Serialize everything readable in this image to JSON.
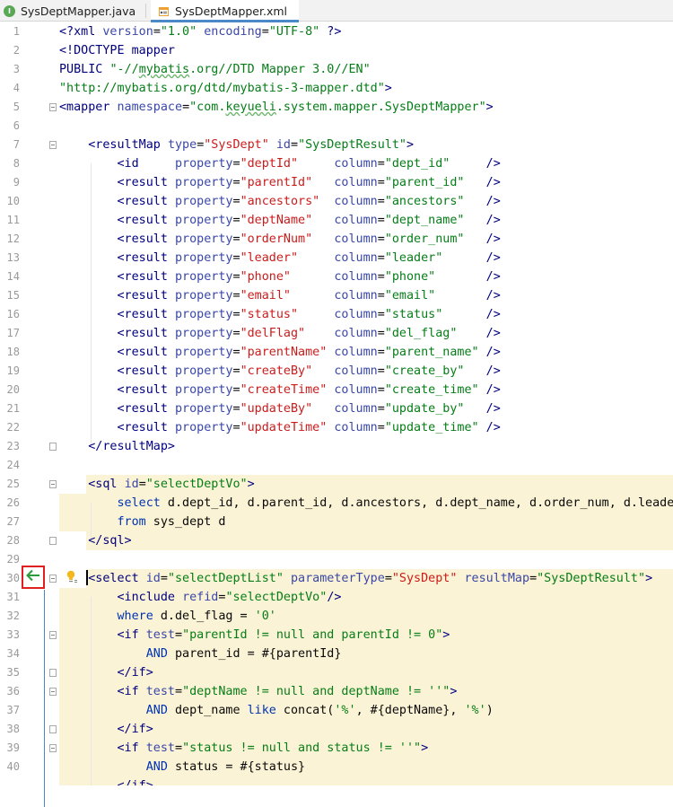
{
  "tabs": [
    {
      "label": "SysDeptMapper.java",
      "icon": "java-interface-icon",
      "active": false
    },
    {
      "label": "SysDeptMapper.xml",
      "icon": "xml-file-icon",
      "active": true
    }
  ],
  "colors": {
    "tag": "#000080",
    "attr": "#3a47a8",
    "value": "#067d17",
    "red_value": "#cc1b1b",
    "keyword": "#0033b3",
    "highlight": "#fbf3d5",
    "accent": "#4a88c7"
  },
  "editor": {
    "line_numbers": [
      "1",
      "2",
      "3",
      "4",
      "5",
      "6",
      "7",
      "8",
      "9",
      "10",
      "11",
      "12",
      "13",
      "14",
      "15",
      "16",
      "17",
      "18",
      "19",
      "20",
      "21",
      "22",
      "23",
      "24",
      "25",
      "26",
      "27",
      "28",
      "29",
      "30",
      "31",
      "32",
      "33",
      "34",
      "35",
      "36",
      "37",
      "38",
      "39",
      "40"
    ],
    "lines": [
      [
        {
          "t": "<?",
          "c": "c-pi"
        },
        {
          "t": "xml ",
          "c": "c-pi"
        },
        {
          "t": "version",
          "c": "c-attr"
        },
        {
          "t": "=",
          "c": "c-txt"
        },
        {
          "t": "\"1.0\"",
          "c": "c-val"
        },
        {
          "t": " ",
          "c": "c-txt"
        },
        {
          "t": "encoding",
          "c": "c-attr"
        },
        {
          "t": "=",
          "c": "c-txt"
        },
        {
          "t": "\"UTF-8\"",
          "c": "c-val"
        },
        {
          "t": " ?>",
          "c": "c-pi"
        }
      ],
      [
        {
          "t": "<!DOCTYPE ",
          "c": "c-tag"
        },
        {
          "t": "mapper",
          "c": "c-tag"
        }
      ],
      [
        {
          "t": "PUBLIC ",
          "c": "c-tag"
        },
        {
          "t": "\"-//",
          "c": "c-val"
        },
        {
          "t": "mybatis",
          "c": "c-val squig"
        },
        {
          "t": ".org//DTD Mapper 3.0//EN\"",
          "c": "c-val"
        }
      ],
      [
        {
          "t": "\"http://mybatis.org/dtd/mybatis-3-mapper.dtd\"",
          "c": "c-val"
        },
        {
          "t": ">",
          "c": "c-tag"
        }
      ],
      [
        {
          "t": "<mapper ",
          "c": "c-tag"
        },
        {
          "t": "namespace",
          "c": "c-attr"
        },
        {
          "t": "=",
          "c": "c-txt"
        },
        {
          "t": "\"com.",
          "c": "c-val"
        },
        {
          "t": "keyueli",
          "c": "c-val squig"
        },
        {
          "t": ".system.mapper.SysDeptMapper\"",
          "c": "c-val"
        },
        {
          "t": ">",
          "c": "c-tag"
        }
      ],
      [],
      [
        {
          "t": "    <resultMap ",
          "c": "c-tag"
        },
        {
          "t": "type",
          "c": "c-attr"
        },
        {
          "t": "=",
          "c": "c-txt"
        },
        {
          "t": "\"SysDept\"",
          "c": "c-red"
        },
        {
          "t": " ",
          "c": "c-txt"
        },
        {
          "t": "id",
          "c": "c-attr"
        },
        {
          "t": "=",
          "c": "c-txt"
        },
        {
          "t": "\"SysDeptResult\"",
          "c": "c-val"
        },
        {
          "t": ">",
          "c": "c-tag"
        }
      ],
      [
        {
          "t": "        <id     ",
          "c": "c-tag"
        },
        {
          "t": "property",
          "c": "c-attr"
        },
        {
          "t": "=",
          "c": "c-txt"
        },
        {
          "t": "\"deptId\"",
          "c": "c-red"
        },
        {
          "t": "     ",
          "c": "c-txt"
        },
        {
          "t": "column",
          "c": "c-attr"
        },
        {
          "t": "=",
          "c": "c-txt"
        },
        {
          "t": "\"dept_id\"",
          "c": "c-val"
        },
        {
          "t": "     />",
          "c": "c-tag"
        }
      ],
      [
        {
          "t": "        <result ",
          "c": "c-tag"
        },
        {
          "t": "property",
          "c": "c-attr"
        },
        {
          "t": "=",
          "c": "c-txt"
        },
        {
          "t": "\"parentId\"",
          "c": "c-red"
        },
        {
          "t": "   ",
          "c": "c-txt"
        },
        {
          "t": "column",
          "c": "c-attr"
        },
        {
          "t": "=",
          "c": "c-txt"
        },
        {
          "t": "\"parent_id\"",
          "c": "c-val"
        },
        {
          "t": "   />",
          "c": "c-tag"
        }
      ],
      [
        {
          "t": "        <result ",
          "c": "c-tag"
        },
        {
          "t": "property",
          "c": "c-attr"
        },
        {
          "t": "=",
          "c": "c-txt"
        },
        {
          "t": "\"ancestors\"",
          "c": "c-red"
        },
        {
          "t": "  ",
          "c": "c-txt"
        },
        {
          "t": "column",
          "c": "c-attr"
        },
        {
          "t": "=",
          "c": "c-txt"
        },
        {
          "t": "\"ancestors\"",
          "c": "c-val"
        },
        {
          "t": "   />",
          "c": "c-tag"
        }
      ],
      [
        {
          "t": "        <result ",
          "c": "c-tag"
        },
        {
          "t": "property",
          "c": "c-attr"
        },
        {
          "t": "=",
          "c": "c-txt"
        },
        {
          "t": "\"deptName\"",
          "c": "c-red"
        },
        {
          "t": "   ",
          "c": "c-txt"
        },
        {
          "t": "column",
          "c": "c-attr"
        },
        {
          "t": "=",
          "c": "c-txt"
        },
        {
          "t": "\"dept_name\"",
          "c": "c-val"
        },
        {
          "t": "   />",
          "c": "c-tag"
        }
      ],
      [
        {
          "t": "        <result ",
          "c": "c-tag"
        },
        {
          "t": "property",
          "c": "c-attr"
        },
        {
          "t": "=",
          "c": "c-txt"
        },
        {
          "t": "\"orderNum\"",
          "c": "c-red"
        },
        {
          "t": "   ",
          "c": "c-txt"
        },
        {
          "t": "column",
          "c": "c-attr"
        },
        {
          "t": "=",
          "c": "c-txt"
        },
        {
          "t": "\"order_num\"",
          "c": "c-val"
        },
        {
          "t": "   />",
          "c": "c-tag"
        }
      ],
      [
        {
          "t": "        <result ",
          "c": "c-tag"
        },
        {
          "t": "property",
          "c": "c-attr"
        },
        {
          "t": "=",
          "c": "c-txt"
        },
        {
          "t": "\"leader\"",
          "c": "c-red"
        },
        {
          "t": "     ",
          "c": "c-txt"
        },
        {
          "t": "column",
          "c": "c-attr"
        },
        {
          "t": "=",
          "c": "c-txt"
        },
        {
          "t": "\"leader\"",
          "c": "c-val"
        },
        {
          "t": "      />",
          "c": "c-tag"
        }
      ],
      [
        {
          "t": "        <result ",
          "c": "c-tag"
        },
        {
          "t": "property",
          "c": "c-attr"
        },
        {
          "t": "=",
          "c": "c-txt"
        },
        {
          "t": "\"phone\"",
          "c": "c-red"
        },
        {
          "t": "      ",
          "c": "c-txt"
        },
        {
          "t": "column",
          "c": "c-attr"
        },
        {
          "t": "=",
          "c": "c-txt"
        },
        {
          "t": "\"phone\"",
          "c": "c-val"
        },
        {
          "t": "       />",
          "c": "c-tag"
        }
      ],
      [
        {
          "t": "        <result ",
          "c": "c-tag"
        },
        {
          "t": "property",
          "c": "c-attr"
        },
        {
          "t": "=",
          "c": "c-txt"
        },
        {
          "t": "\"email\"",
          "c": "c-red"
        },
        {
          "t": "      ",
          "c": "c-txt"
        },
        {
          "t": "column",
          "c": "c-attr"
        },
        {
          "t": "=",
          "c": "c-txt"
        },
        {
          "t": "\"email\"",
          "c": "c-val"
        },
        {
          "t": "       />",
          "c": "c-tag"
        }
      ],
      [
        {
          "t": "        <result ",
          "c": "c-tag"
        },
        {
          "t": "property",
          "c": "c-attr"
        },
        {
          "t": "=",
          "c": "c-txt"
        },
        {
          "t": "\"status\"",
          "c": "c-red"
        },
        {
          "t": "     ",
          "c": "c-txt"
        },
        {
          "t": "column",
          "c": "c-attr"
        },
        {
          "t": "=",
          "c": "c-txt"
        },
        {
          "t": "\"status\"",
          "c": "c-val"
        },
        {
          "t": "      />",
          "c": "c-tag"
        }
      ],
      [
        {
          "t": "        <result ",
          "c": "c-tag"
        },
        {
          "t": "property",
          "c": "c-attr"
        },
        {
          "t": "=",
          "c": "c-txt"
        },
        {
          "t": "\"delFlag\"",
          "c": "c-red"
        },
        {
          "t": "    ",
          "c": "c-txt"
        },
        {
          "t": "column",
          "c": "c-attr"
        },
        {
          "t": "=",
          "c": "c-txt"
        },
        {
          "t": "\"del_flag\"",
          "c": "c-val"
        },
        {
          "t": "    />",
          "c": "c-tag"
        }
      ],
      [
        {
          "t": "        <result ",
          "c": "c-tag"
        },
        {
          "t": "property",
          "c": "c-attr"
        },
        {
          "t": "=",
          "c": "c-txt"
        },
        {
          "t": "\"parentName\"",
          "c": "c-red"
        },
        {
          "t": " ",
          "c": "c-txt"
        },
        {
          "t": "column",
          "c": "c-attr"
        },
        {
          "t": "=",
          "c": "c-txt"
        },
        {
          "t": "\"parent_name\"",
          "c": "c-val"
        },
        {
          "t": " />",
          "c": "c-tag"
        }
      ],
      [
        {
          "t": "        <result ",
          "c": "c-tag"
        },
        {
          "t": "property",
          "c": "c-attr"
        },
        {
          "t": "=",
          "c": "c-txt"
        },
        {
          "t": "\"createBy\"",
          "c": "c-red"
        },
        {
          "t": "   ",
          "c": "c-txt"
        },
        {
          "t": "column",
          "c": "c-attr"
        },
        {
          "t": "=",
          "c": "c-txt"
        },
        {
          "t": "\"create_by\"",
          "c": "c-val"
        },
        {
          "t": "   />",
          "c": "c-tag"
        }
      ],
      [
        {
          "t": "        <result ",
          "c": "c-tag"
        },
        {
          "t": "property",
          "c": "c-attr"
        },
        {
          "t": "=",
          "c": "c-txt"
        },
        {
          "t": "\"createTime\"",
          "c": "c-red"
        },
        {
          "t": " ",
          "c": "c-txt"
        },
        {
          "t": "column",
          "c": "c-attr"
        },
        {
          "t": "=",
          "c": "c-txt"
        },
        {
          "t": "\"create_time\"",
          "c": "c-val"
        },
        {
          "t": " />",
          "c": "c-tag"
        }
      ],
      [
        {
          "t": "        <result ",
          "c": "c-tag"
        },
        {
          "t": "property",
          "c": "c-attr"
        },
        {
          "t": "=",
          "c": "c-txt"
        },
        {
          "t": "\"updateBy\"",
          "c": "c-red"
        },
        {
          "t": "   ",
          "c": "c-txt"
        },
        {
          "t": "column",
          "c": "c-attr"
        },
        {
          "t": "=",
          "c": "c-txt"
        },
        {
          "t": "\"update_by\"",
          "c": "c-val"
        },
        {
          "t": "   />",
          "c": "c-tag"
        }
      ],
      [
        {
          "t": "        <result ",
          "c": "c-tag"
        },
        {
          "t": "property",
          "c": "c-attr"
        },
        {
          "t": "=",
          "c": "c-txt"
        },
        {
          "t": "\"updateTime\"",
          "c": "c-red"
        },
        {
          "t": " ",
          "c": "c-txt"
        },
        {
          "t": "column",
          "c": "c-attr"
        },
        {
          "t": "=",
          "c": "c-txt"
        },
        {
          "t": "\"update_time\"",
          "c": "c-val"
        },
        {
          "t": " />",
          "c": "c-tag"
        }
      ],
      [
        {
          "t": "    </resultMap>",
          "c": "c-tag"
        }
      ],
      [],
      [
        {
          "t": "    <sql ",
          "c": "c-tag"
        },
        {
          "t": "id",
          "c": "c-attr"
        },
        {
          "t": "=",
          "c": "c-txt"
        },
        {
          "t": "\"selectDeptVo\"",
          "c": "c-val"
        },
        {
          "t": ">",
          "c": "c-tag"
        }
      ],
      [
        {
          "t": "        ",
          "c": "c-txt"
        },
        {
          "t": "select",
          "c": "c-kw"
        },
        {
          "t": " d.dept_id, d.parent_id, d.ancestors, d.dept_name, d.order_num, d.leader",
          "c": "c-txt"
        }
      ],
      [
        {
          "t": "        ",
          "c": "c-txt"
        },
        {
          "t": "from",
          "c": "c-kw"
        },
        {
          "t": " sys_dept d",
          "c": "c-txt"
        }
      ],
      [
        {
          "t": "    </sql>",
          "c": "c-tag"
        }
      ],
      [],
      [
        {
          "t": "    <select ",
          "c": "c-tag"
        },
        {
          "t": "id",
          "c": "c-attr"
        },
        {
          "t": "=",
          "c": "c-txt"
        },
        {
          "t": "\"selectDeptList\"",
          "c": "c-val"
        },
        {
          "t": " ",
          "c": "c-txt"
        },
        {
          "t": "parameterType",
          "c": "c-attr"
        },
        {
          "t": "=",
          "c": "c-txt"
        },
        {
          "t": "\"SysDept\"",
          "c": "c-red"
        },
        {
          "t": " ",
          "c": "c-txt"
        },
        {
          "t": "resultMap",
          "c": "c-attr"
        },
        {
          "t": "=",
          "c": "c-txt"
        },
        {
          "t": "\"SysDeptResult\"",
          "c": "c-val"
        },
        {
          "t": ">",
          "c": "c-tag"
        }
      ],
      [
        {
          "t": "        <include ",
          "c": "c-tag"
        },
        {
          "t": "refid",
          "c": "c-attr"
        },
        {
          "t": "=",
          "c": "c-txt"
        },
        {
          "t": "\"selectDeptVo\"",
          "c": "c-val"
        },
        {
          "t": "/>",
          "c": "c-tag"
        }
      ],
      [
        {
          "t": "        ",
          "c": "c-txt"
        },
        {
          "t": "where",
          "c": "c-kw"
        },
        {
          "t": " d.del_flag = ",
          "c": "c-txt"
        },
        {
          "t": "'0'",
          "c": "c-val"
        }
      ],
      [
        {
          "t": "        <if ",
          "c": "c-tag"
        },
        {
          "t": "test",
          "c": "c-attr"
        },
        {
          "t": "=",
          "c": "c-txt"
        },
        {
          "t": "\"parentId != null and parentId != 0\"",
          "c": "c-val"
        },
        {
          "t": ">",
          "c": "c-tag"
        }
      ],
      [
        {
          "t": "            ",
          "c": "c-txt"
        },
        {
          "t": "AND",
          "c": "c-kw"
        },
        {
          "t": " parent_id = #{parentId}",
          "c": "c-txt"
        }
      ],
      [
        {
          "t": "        </if>",
          "c": "c-tag"
        }
      ],
      [
        {
          "t": "        <if ",
          "c": "c-tag"
        },
        {
          "t": "test",
          "c": "c-attr"
        },
        {
          "t": "=",
          "c": "c-txt"
        },
        {
          "t": "\"deptName != null and deptName != ''\"",
          "c": "c-val"
        },
        {
          "t": ">",
          "c": "c-tag"
        }
      ],
      [
        {
          "t": "            ",
          "c": "c-txt"
        },
        {
          "t": "AND",
          "c": "c-kw"
        },
        {
          "t": " dept_name ",
          "c": "c-txt"
        },
        {
          "t": "like",
          "c": "c-kw"
        },
        {
          "t": " concat(",
          "c": "c-txt"
        },
        {
          "t": "'%'",
          "c": "c-val"
        },
        {
          "t": ", #{deptName}, ",
          "c": "c-txt"
        },
        {
          "t": "'%'",
          "c": "c-val"
        },
        {
          "t": ")",
          "c": "c-txt"
        }
      ],
      [
        {
          "t": "        </if>",
          "c": "c-tag"
        }
      ],
      [
        {
          "t": "        <if ",
          "c": "c-tag"
        },
        {
          "t": "test",
          "c": "c-attr"
        },
        {
          "t": "=",
          "c": "c-txt"
        },
        {
          "t": "\"status != null and status != ''\"",
          "c": "c-val"
        },
        {
          "t": ">",
          "c": "c-tag"
        }
      ],
      [
        {
          "t": "            ",
          "c": "c-txt"
        },
        {
          "t": "AND",
          "c": "c-kw"
        },
        {
          "t": " status = #{status}",
          "c": "c-txt"
        }
      ]
    ],
    "partial_last_line": "        </if>"
  },
  "gutter": {
    "back_button_icon": "arrow-left-icon",
    "intention_icon": "lightbulb-icon"
  }
}
